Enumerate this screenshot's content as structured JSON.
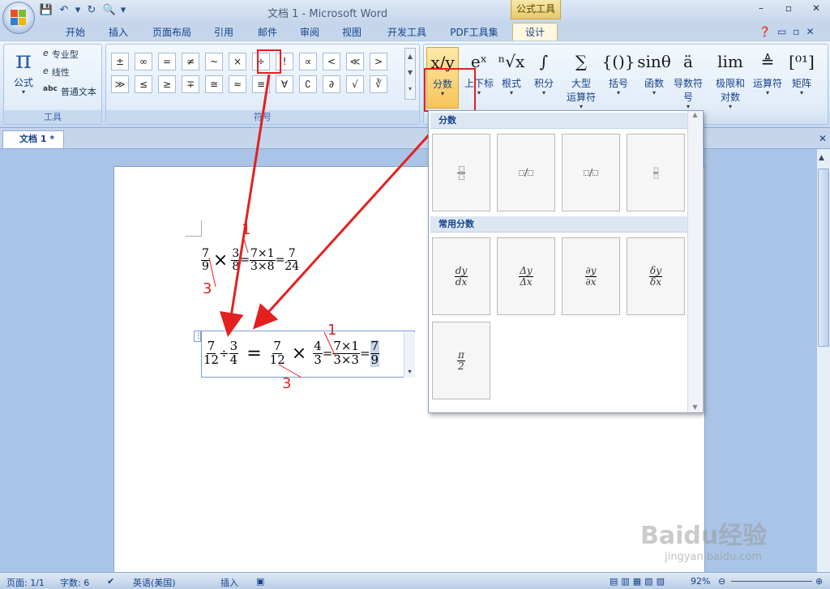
{
  "window": {
    "title": "文档 1 - Microsoft Word",
    "context_tab": "公式工具",
    "min": "–",
    "max": "▫",
    "close": "✕"
  },
  "qat": [
    "💾",
    "↶",
    "▾",
    "↻",
    "🔍",
    "▾"
  ],
  "tabs": [
    "开始",
    "插入",
    "页面布局",
    "引用",
    "邮件",
    "审阅",
    "视图",
    "开发工具",
    "PDF工具集",
    "设计"
  ],
  "tools": {
    "formula": "公式",
    "professional": "专业型",
    "linear": "线性",
    "plain": "普通文本",
    "label": "工具",
    "formula_glyph": "π",
    "prof_glyph": "e",
    "linear_glyph": "e",
    "abc": "abc"
  },
  "symbols": {
    "row1": [
      "±",
      "∞",
      "=",
      "≠",
      "~",
      "×",
      "÷",
      "!",
      "∝",
      "<",
      "≪",
      ">"
    ],
    "row2": [
      "≫",
      "≤",
      "≥",
      "∓",
      "≅",
      "≈",
      "≡",
      "∀",
      "∁",
      "∂",
      "√",
      "∛"
    ],
    "label": "符号"
  },
  "structures": [
    {
      "label": "分数",
      "icon": "x/y"
    },
    {
      "label": "上下标",
      "icon": "eˣ"
    },
    {
      "label": "根式",
      "icon": "ⁿ√x"
    },
    {
      "label": "积分",
      "icon": "∫"
    },
    {
      "label": "大型\n运算符",
      "icon": "∑"
    },
    {
      "label": "括号",
      "icon": "{()}"
    },
    {
      "label": "函数",
      "icon": "sinθ"
    },
    {
      "label": "导数符号",
      "icon": "ä"
    },
    {
      "label": "极限和\n对数",
      "icon": "lim"
    },
    {
      "label": "运算符",
      "icon": "≜"
    },
    {
      "label": "矩阵",
      "icon": "[⁰¹]"
    }
  ],
  "doc_tab": "文档 1 *",
  "gallery": {
    "section1": "分数",
    "section2": "常用分数",
    "common": [
      [
        "dy",
        "dx"
      ],
      [
        "Δy",
        "Δx"
      ],
      [
        "∂y",
        "∂x"
      ],
      [
        "δy",
        "δx"
      ],
      [
        "π",
        "2"
      ]
    ]
  },
  "eq1": {
    "a": [
      "7",
      "9"
    ],
    "times": "×",
    "b": [
      "3",
      "8"
    ],
    "c": [
      "7×1",
      "3×8"
    ],
    "d": [
      "7",
      "24"
    ],
    "ann_top": "1",
    "ann_bottom": "3"
  },
  "eq2": {
    "a": [
      "7",
      "12"
    ],
    "div": "÷",
    "b": [
      "3",
      "4"
    ],
    "c": [
      "7",
      "12"
    ],
    "times": "×",
    "d": [
      "4",
      "3"
    ],
    "e": [
      "7×1",
      "3×3"
    ],
    "f": [
      "7",
      "9"
    ],
    "ann_top": "1",
    "ann_bottom": "3"
  },
  "status": {
    "page": "页面: 1/1",
    "words": "字数: 6",
    "lang": "英语(美国)",
    "mode": "插入",
    "zoom": "92%"
  },
  "watermark": {
    "brand": "Baidu经验",
    "url": "jingyan.baidu.com"
  }
}
